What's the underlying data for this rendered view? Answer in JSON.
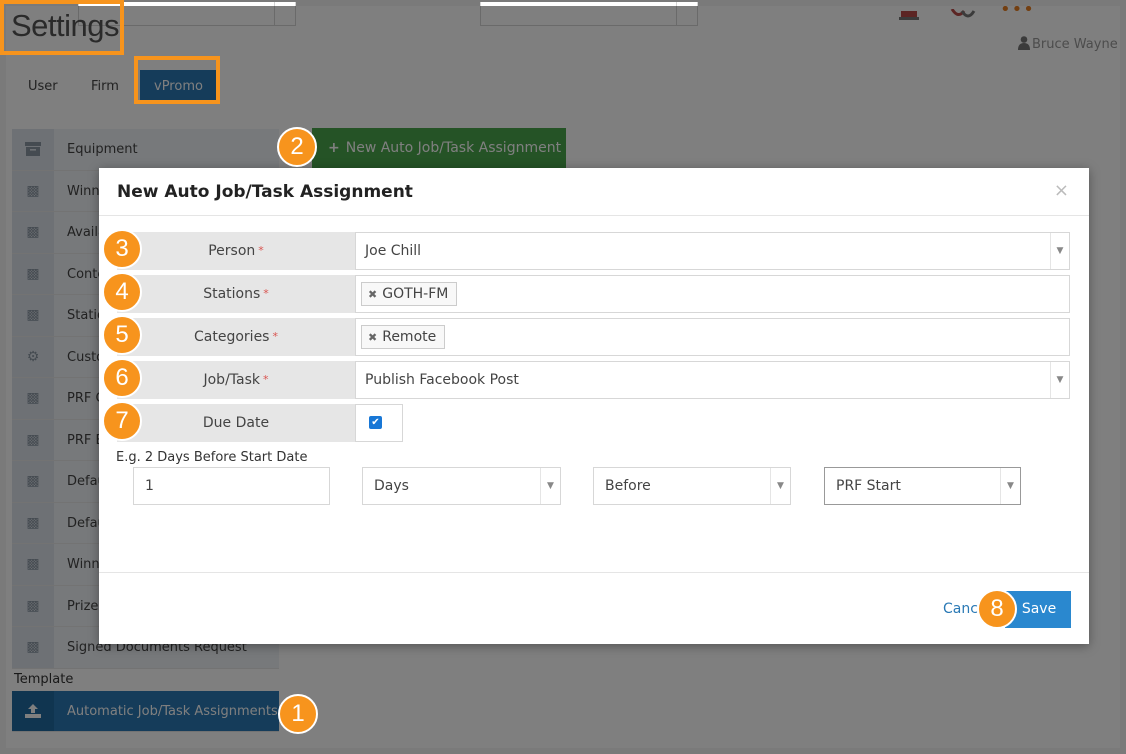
{
  "page": {
    "title": "Settings",
    "user_name": "Bruce Wayne"
  },
  "tabs": [
    {
      "label": "User"
    },
    {
      "label": "Firm"
    },
    {
      "label": "vPromo"
    }
  ],
  "sidebar": {
    "items": [
      {
        "label": "Equipment",
        "icon": "archive-icon"
      },
      {
        "label": "Winners",
        "icon": "sitemap-icon"
      },
      {
        "label": "Availability",
        "icon": "sitemap-icon"
      },
      {
        "label": "Contest",
        "icon": "sitemap-icon"
      },
      {
        "label": "Stations",
        "icon": "sitemap-icon"
      },
      {
        "label": "Custom",
        "icon": "gear-icon"
      },
      {
        "label": "PRF C",
        "icon": "sitemap-icon"
      },
      {
        "label": "PRF E",
        "icon": "sitemap-icon"
      },
      {
        "label": "Default",
        "icon": "sitemap-icon"
      },
      {
        "label": "Default",
        "icon": "sitemap-icon"
      },
      {
        "label": "Winners",
        "icon": "sitemap-icon"
      },
      {
        "label": "Prize",
        "icon": "sitemap-icon"
      },
      {
        "label": "Signed Documents Request",
        "icon": "sitemap-icon"
      }
    ],
    "group_label": "Template",
    "selected_item": {
      "label": "Automatic Job/Task Assignments",
      "icon": "upload-icon"
    }
  },
  "new_button": {
    "label": "New Auto Job/Task Assignment"
  },
  "steps": [
    "1",
    "2",
    "3",
    "4",
    "5",
    "6",
    "7",
    "8"
  ],
  "modal": {
    "title": "New Auto Job/Task Assignment",
    "close": "×",
    "required_mark": "*",
    "person": {
      "label": "Person",
      "value": "Joe Chill"
    },
    "stations": {
      "label": "Stations",
      "tag": "GOTH-FM"
    },
    "categories": {
      "label": "Categories",
      "tag": "Remote"
    },
    "job_task": {
      "label": "Job/Task",
      "value": "Publish Facebook Post"
    },
    "due_date": {
      "label": "Due Date",
      "checked": true
    },
    "example": "E.g. 2 Days Before Start Date",
    "offset_value": "1",
    "unit": "Days",
    "relation": "Before",
    "anchor": "PRF Start",
    "cancel_label": "Cancel",
    "save_label": "Save"
  },
  "colors": {
    "accent_blue": "#2a79b5",
    "green_button": "#4aa64c",
    "callout_orange": "#f7941d",
    "required_red": "#d9534f"
  }
}
